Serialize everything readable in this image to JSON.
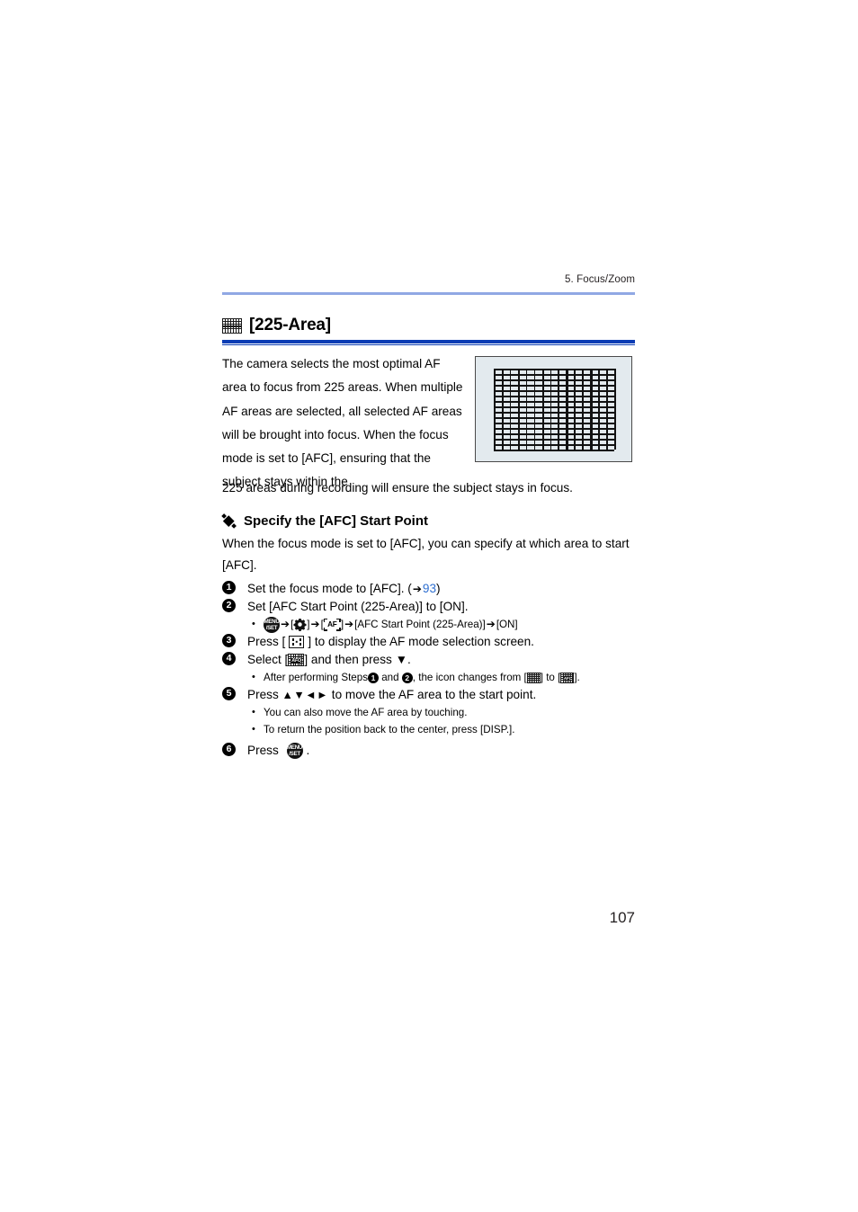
{
  "page": {
    "running_head": "5. Focus/Zoom",
    "page_number": "107",
    "rule_color": "#90a8e4",
    "heading_rule_color": "#0b3cb4",
    "link_color": "#2f6fd0"
  },
  "section": {
    "icon": "225-area-grid-icon",
    "title": "[225-Area]",
    "paragraph_left": "The camera selects the most optimal AF area to focus from 225 areas. When multiple AF areas are selected, all selected AF areas will be brought into focus. When the focus mode is set to [AFC], ensuring that the subject stays within the",
    "paragraph_full": "225 areas during recording will ensure the subject stays in focus.",
    "illustration": {
      "name": "225-area-grid-illustration",
      "rows": 15,
      "cols": 15,
      "background": "#e3eaee"
    }
  },
  "subsection": {
    "bullet": "diamond-bullet-icon",
    "heading": "Specify the [AFC] Start Point",
    "intro": "When the focus mode is set to [AFC], you can specify at which area to start [AFC]."
  },
  "steps": [
    {
      "number": "1",
      "text_before": "Set the focus mode to [AFC]. (",
      "arrow": "➔",
      "link": "93",
      "text_after": ")"
    },
    {
      "number": "2",
      "text": "Set [AFC Start Point (225-Area)] to [ON].",
      "menu_path": {
        "menu_button": "menu-set-button-icon",
        "arrow": "➔",
        "gear": "custom-gear-icon",
        "af_icon": "af-bracket-icon",
        "item": "[AFC Start Point (225-Area)]",
        "value": "[ON]"
      }
    },
    {
      "number": "3",
      "text_before": "Press [",
      "icon": "af-mode-button-icon",
      "text_after": "] to display the AF mode selection screen."
    },
    {
      "number": "4",
      "text_before": "Select [",
      "icon": "225-area-afc-grid-icon",
      "text_after": "] and then press ▼.",
      "note": {
        "prefix": "After performing Steps ",
        "step_a": "1",
        "mid": " and ",
        "step_b": "2",
        "after": ", the icon changes from [",
        "icon_from": "225-area-grid-icon",
        "between": "] to [",
        "icon_to": "225-area-afc-grid-icon",
        "end": "]."
      }
    },
    {
      "number": "5",
      "text_before": "Press ",
      "arrows": "▲▼◄►",
      "text_after": " to move the AF area to the start point.",
      "notes": [
        "You can also move the AF area by touching.",
        "To return the position back to the center, press [DISP.]."
      ]
    },
    {
      "number": "6",
      "text_before": "Press ",
      "icon": "menu-set-button-icon",
      "text_after": "."
    }
  ]
}
